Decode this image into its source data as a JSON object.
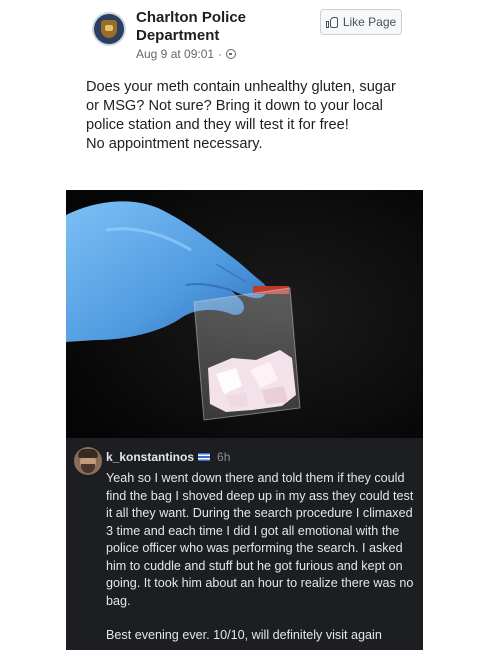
{
  "post": {
    "page_name": "Charlton Police Department",
    "timestamp": "Aug 9 at 09:01",
    "separator": "·",
    "like_page_label": "Like Page",
    "text_lines": [
      "Does your meth contain unhealthy gluten, sugar or MSG? Not sure? Bring it down to your local police station and they will test it for free!",
      "No appointment necessary."
    ]
  },
  "comment": {
    "username": "k_konstantinos",
    "time": "6h",
    "paragraphs": [
      "Yeah so I went down there and told them if they could find the bag I shoved deep up in my ass they could test it all they want. During the search procedure I climaxed 3 time and each time I did I got all emotional with the police officer who was performing the search. I asked him to cuddle and stuff but he got furious and kept on going. It took him about an hour to realize there was no bag.",
      "Best evening ever. 10/10, will definitely visit again"
    ]
  },
  "icons": {
    "globe": "globe-icon",
    "thumb": "thumbs-up-icon",
    "flag": "greek-flag-icon"
  },
  "colors": {
    "comment_bg": "#1c1e21",
    "photo_bg": "#0c0c0c",
    "glove": "#5fa8e8"
  }
}
